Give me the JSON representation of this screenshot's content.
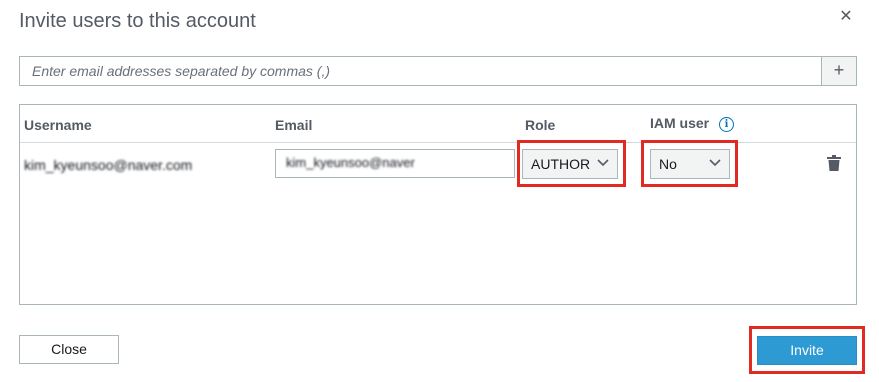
{
  "dialog": {
    "title": "Invite users to this account",
    "close_glyph": "✕"
  },
  "email_entry": {
    "placeholder": "Enter email addresses separated by commas (,)",
    "add_glyph": "+"
  },
  "table": {
    "columns": {
      "username": "Username",
      "email": "Email",
      "role": "Role",
      "iam_user": "IAM user"
    },
    "info_glyph": "i",
    "rows": [
      {
        "username": "kim_kyeunsoo@naver.com",
        "email": "kim_kyeunsoo@naver",
        "role": "AUTHOR",
        "iam_user": "No"
      }
    ]
  },
  "footer": {
    "close_label": "Close",
    "invite_label": "Invite"
  },
  "colors": {
    "primary": "#2d9ad4",
    "highlight": "#e02a22",
    "info": "#0073bb"
  },
  "icons": [
    "close-icon",
    "plus-icon",
    "info-icon",
    "chevron-down-icon",
    "trash-icon"
  ]
}
